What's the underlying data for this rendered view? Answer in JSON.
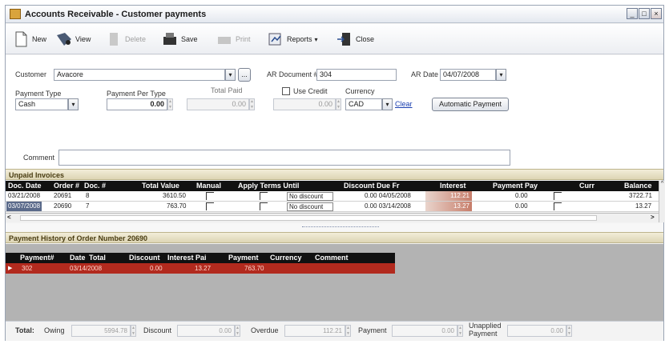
{
  "window": {
    "title": "Accounts Receivable - Customer payments",
    "controls": {
      "minimize": "_",
      "maximize": "□",
      "close": "×"
    }
  },
  "toolbar": {
    "new": "New",
    "view": "View",
    "delete": "Delete",
    "save": "Save",
    "print": "Print",
    "reports": "Reports",
    "close": "Close"
  },
  "form": {
    "customer_label": "Customer",
    "customer_value": "Avacore",
    "customer_browse": "...",
    "ar_document_label": "AR Document #",
    "ar_document_value": "304",
    "ar_date_label": "AR Date",
    "ar_date_value": "04/07/2008",
    "payment_type_label": "Payment Type",
    "payment_type_value": "Cash",
    "payment_per_type_label": "Payment Per Type",
    "payment_per_type_value": "0.00",
    "total_paid_label": "Total Paid",
    "total_paid_value": "0.00",
    "use_credit_label": "Use Credit",
    "use_credit_value": "0.00",
    "currency_label": "Currency",
    "currency_value": "CAD",
    "clear_link": "Clear",
    "automatic_payment_button": "Automatic Payment",
    "comment_label": "Comment",
    "comment_value": ""
  },
  "unpaid": {
    "section_title": "Unpaid Invoices",
    "columns": [
      "Doc. Date",
      "Order #",
      "Doc. #",
      "Total Value",
      "Manual",
      "Apply Terms Until",
      "Discount Due Fr",
      "Interest",
      "Payment Pay",
      "Curr",
      "Balance"
    ],
    "rows": [
      {
        "doc_date": "03/21/2008",
        "order": "20691",
        "doc": "8",
        "total": "3610.50",
        "discount": "No discount",
        "disc_due": "0.00 04/05/2008",
        "interest": "112.21",
        "payment": "0.00",
        "balance": "3722.71"
      },
      {
        "doc_date": "03/07/2008",
        "order": "20690",
        "doc": "7",
        "total": "763.70",
        "discount": "No discount",
        "disc_due": "0.00 03/14/2008",
        "interest": "13.27",
        "payment": "0.00",
        "balance": "13.27"
      }
    ],
    "scroll_left": "<",
    "scroll_right": ">",
    "scroll_up": "^",
    "scroll_down": "v"
  },
  "history": {
    "section_title": "Payment History of Order Number 20690",
    "columns": [
      "Payment#",
      "Date",
      "Total",
      "Discount",
      "Interest Pai",
      "Payment",
      "Currency",
      "Comment"
    ],
    "rows": [
      {
        "payment_no": "302",
        "date": "03/14/2008",
        "discount": "0.00",
        "interest": "13.27",
        "payment": "763.70"
      }
    ],
    "row_marker": "▶"
  },
  "totals": {
    "total_label": "Total:",
    "owing_label": "Owing",
    "owing_value": "5994.78",
    "discount_label": "Discount",
    "discount_value": "0.00",
    "overdue_label": "Overdue",
    "overdue_value": "112.21",
    "payment_label": "Payment",
    "payment_value": "0.00",
    "unapplied_label_1": "Unapplied",
    "unapplied_label_2": "Payment",
    "unapplied_value": "0.00"
  },
  "colors": {
    "accent_header": "#ddd5b4",
    "history_row": "#b22a1e",
    "grid_header": "#111111"
  }
}
